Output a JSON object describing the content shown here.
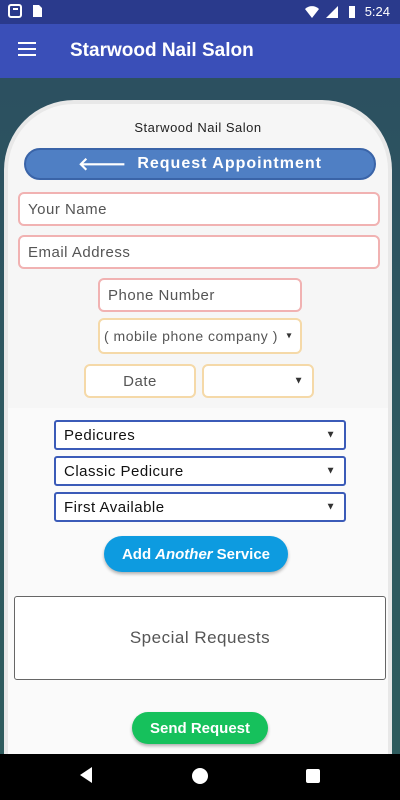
{
  "status_bar": {
    "time": "5:24"
  },
  "app_bar": {
    "title": "Starwood Nail Salon"
  },
  "card": {
    "salon_name": "Starwood Nail Salon",
    "request_button": "Request Appointment",
    "fields": {
      "name_placeholder": "Your Name",
      "email_placeholder": "Email Address",
      "phone_placeholder": "Phone Number",
      "carrier_select": "( mobile phone company )",
      "date_placeholder": "Date",
      "time_select": ""
    },
    "services": {
      "category": "Pedicures",
      "service": "Classic Pedicure",
      "technician": "First Available"
    },
    "add_service": {
      "prefix": "Add",
      "emphasis": "Another",
      "suffix": "Service"
    },
    "special_requests": "Special Requests",
    "send_button": "Send Request"
  },
  "colors": {
    "app_bar": "#3a4fb8",
    "request_button": "#4f7fc4",
    "add_button": "#0d9be0",
    "send_button": "#16c15c"
  }
}
